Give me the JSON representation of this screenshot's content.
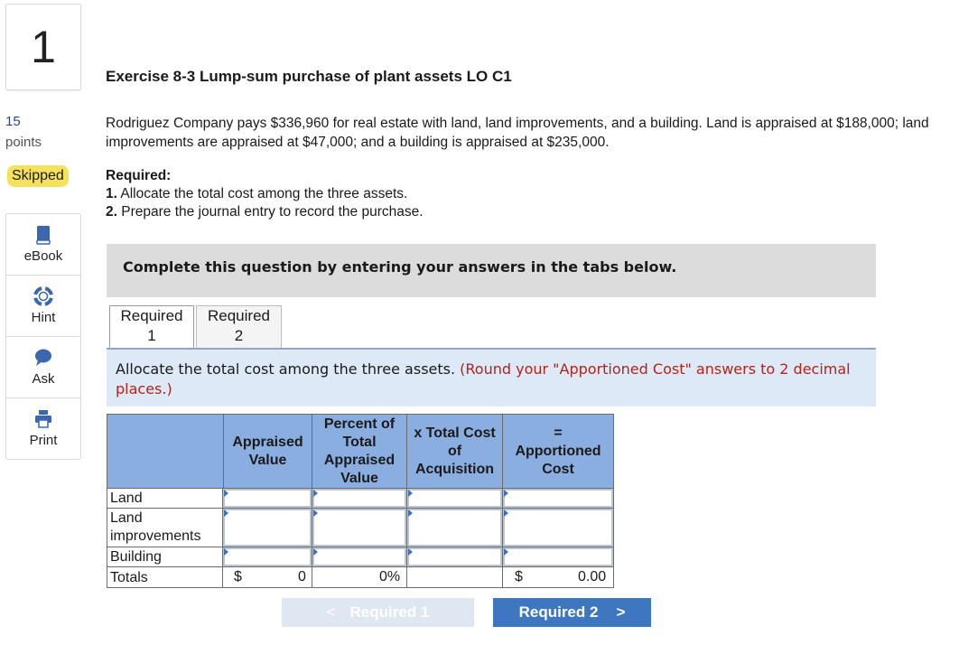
{
  "question": {
    "number": "1",
    "points_value": "15",
    "points_label": "points",
    "status": "Skipped"
  },
  "tools": [
    {
      "label": "eBook",
      "icon": "book-icon"
    },
    {
      "label": "Hint",
      "icon": "lifebuoy-icon"
    },
    {
      "label": "Ask",
      "icon": "chat-bubble-icon"
    },
    {
      "label": "Print",
      "icon": "printer-icon"
    }
  ],
  "exercise": {
    "title": "Exercise 8-3 Lump-sum purchase of plant assets LO C1",
    "problem": "Rodriguez Company pays $336,960 for real estate with land, land improvements, and a building. Land is appraised at $188,000; land improvements are appraised at $47,000; and a building is appraised at $235,000.",
    "required_heading": "Required:",
    "required_1_num": "1.",
    "required_1_text": " Allocate the total cost among the three assets.",
    "required_2_num": "2.",
    "required_2_text": " Prepare the journal entry to record the purchase."
  },
  "banner": "Complete this question by entering your answers in the tabs below.",
  "tabs": [
    {
      "line1": "Required",
      "line2": "1"
    },
    {
      "line1": "Required",
      "line2": "2"
    }
  ],
  "instruction": {
    "text": "Allocate the total cost among the three assets.",
    "note": "(Round your \"Apportioned Cost\" answers to 2 decimal places.)"
  },
  "table": {
    "headers": {
      "appraised": "Appraised Value",
      "percent": "Percent of Total Appraised Value",
      "total_cost": "x Total Cost of Acquisition",
      "equals": "=",
      "apportioned": "Apportioned Cost"
    },
    "rows": [
      {
        "label": "Land"
      },
      {
        "label": "Land improvements"
      },
      {
        "label": "Building"
      }
    ],
    "totals": {
      "label": "Totals",
      "currency1": "$",
      "appraised": "0",
      "percent": "0%",
      "currency2": "$",
      "apportioned": "0.00"
    }
  },
  "nav": {
    "prev_label": "Required 1",
    "next_label": "Required 2",
    "prev_arrow": "<",
    "next_arrow": ">"
  },
  "colors": {
    "header_blue": "#8aaee0",
    "next_button": "#3f76c0",
    "instruction_bg": "#dde9f6",
    "note_red": "#b42318",
    "skipped_badge": "#f6e15a"
  }
}
